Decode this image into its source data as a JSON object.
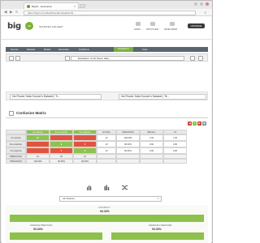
{
  "browser": {
    "tab_title": "BigML · Evaluation",
    "url": "https://bigml.com/dashboard/evaluation/51..."
  },
  "app": {
    "logo_text": "big",
    "logo_badge": "ml",
    "nav": [
      "SOURCES",
      "GALLERY"
    ],
    "user_links": [
      "ADMIN",
      "WHAT'S NEW",
      "DEVELOPERS"
    ],
    "upgrade_label": "UPGRADE"
  },
  "toolbar": {
    "items": [
      "Sources",
      "Datasets",
      "Models",
      "Ensembles",
      "Predictions",
      "Evaluations",
      "Tasks"
    ],
    "active": "Evaluations"
  },
  "evaluation": {
    "title": "Evaluation of Iris flower data ..."
  },
  "datasets": {
    "left": "Iris Flower Data Source's Dataset | Tr...",
    "right": "Iris Flower Data Source's Dataset | Te..."
  },
  "confusion_matrix": {
    "title": "Confusion Matrix",
    "headers": [
      "",
      "Iris-setosa",
      "Iris-versicolor",
      "Iris-virginica",
      "ACTUAL",
      "PRECISION",
      "RECALL",
      "F1"
    ],
    "rows": [
      {
        "label": "Iris-setosa",
        "cells": [
          "10",
          "",
          ""
        ],
        "actual": "10",
        "precision": "100.00%",
        "recall": "1.00",
        "f1": "1.00"
      },
      {
        "label": "Iris-versicolor",
        "cells": [
          "",
          "9",
          "1"
        ],
        "actual": "10",
        "precision": "90.00%",
        "recall": "0.90",
        "f1": "0.90"
      },
      {
        "label": "Iris-virginica",
        "cells": [
          "",
          "1",
          "9"
        ],
        "actual": "10",
        "precision": "90.00%",
        "recall": "0.90",
        "f1": "0.90"
      }
    ],
    "predicted_row": {
      "label": "PREDICTED",
      "values": [
        "10",
        "10",
        "10",
        "",
        "",
        "",
        ""
      ]
    },
    "precision_row": {
      "label": "PRECISION",
      "values": [
        "100.00%",
        "90.00%",
        "90.00%",
        "",
        "",
        "",
        ""
      ]
    },
    "colors": {
      "green": "#8dc34b",
      "red": "#e2533f",
      "header": "#e8e8e8"
    }
  },
  "metrics": {
    "class_select": "All Classes",
    "accuracy_label": "ACCURACY",
    "accuracy_value": "93.33%",
    "precision_label": "AVERAGE PRECISION",
    "precision_value": "93.33%",
    "fmeasure_label": "AVERAGE F-MEASURE",
    "fmeasure_value": "93.33%"
  }
}
